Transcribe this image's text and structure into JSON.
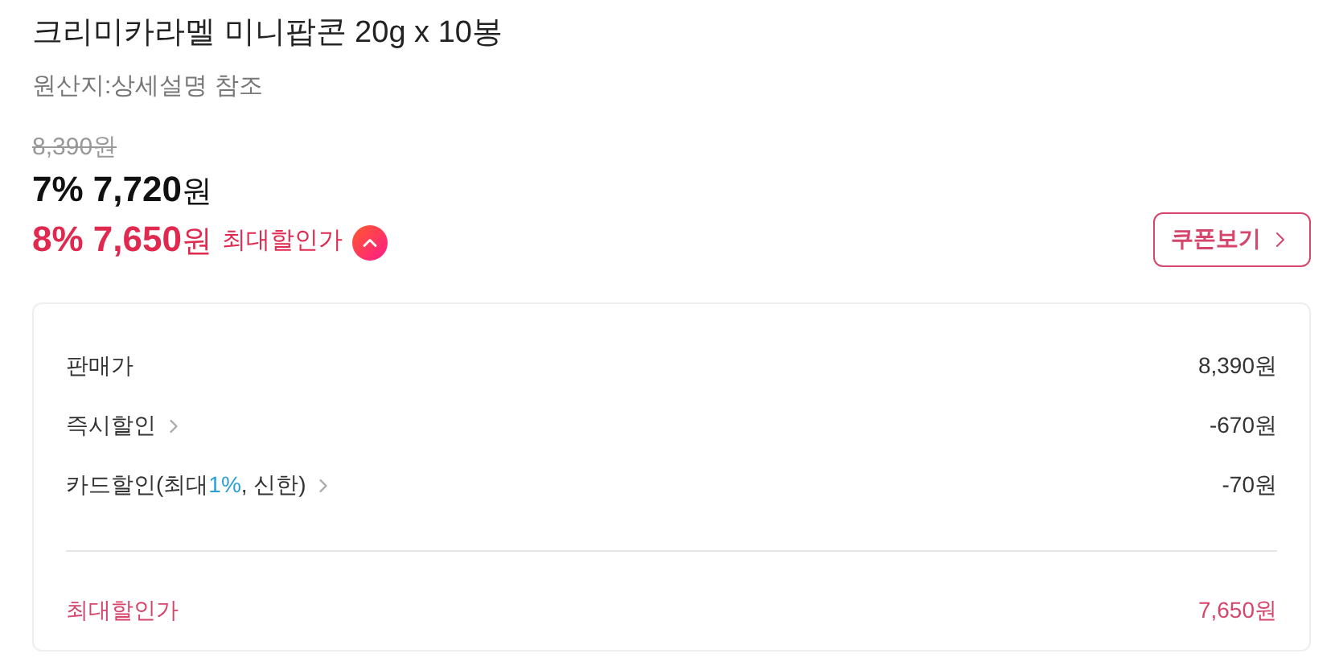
{
  "product": {
    "title": "크리미카라멜 미니팝콘 20g x 10봉",
    "origin": "원산지:상세설명 참조"
  },
  "prices": {
    "original": "8,390원",
    "sale_percent": "7%",
    "sale_amount": "7,720",
    "sale_unit": "원",
    "max_percent": "8%",
    "max_amount": "7,650",
    "max_unit": "원",
    "max_label": "최대할인가",
    "expanded": true
  },
  "coupon_button": "쿠폰보기",
  "breakdown": {
    "rows": [
      {
        "label": "판매가",
        "value": "8,390원",
        "has_link": false
      },
      {
        "label": "즉시할인",
        "value": "-670원",
        "has_link": true
      },
      {
        "label": "카드할인(최대",
        "highlight": "1%",
        "label_end": ", 신한)",
        "value": "-70원",
        "has_link": true
      }
    ],
    "total": {
      "label": "최대할인가",
      "value": "7,650원"
    }
  }
}
